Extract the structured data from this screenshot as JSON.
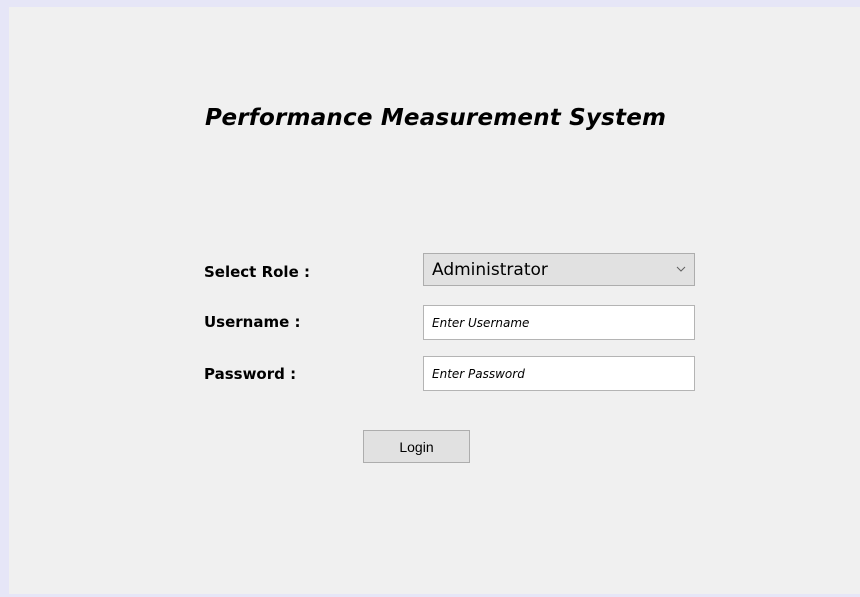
{
  "app": {
    "title": "Performance Measurement System"
  },
  "form": {
    "role_label": "Select Role :",
    "role_value": "Administrator",
    "username_label": "Username :",
    "username_placeholder": "Enter Username",
    "password_label": "Password :",
    "password_placeholder": "Enter Password",
    "login_label": "Login"
  },
  "icons": {
    "dropdown": "chevron-down-icon"
  },
  "colors": {
    "window_background": "#f0f0f0",
    "outer_border": "#e6e6f7",
    "button_face": "#e1e1e1"
  }
}
